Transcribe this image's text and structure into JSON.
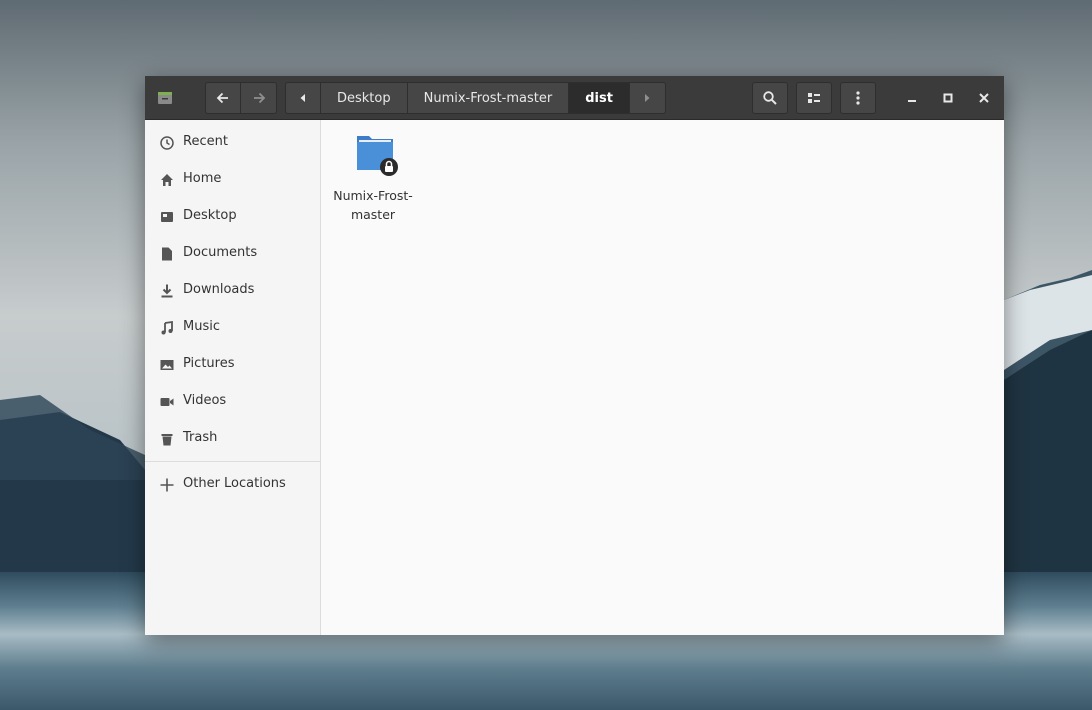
{
  "nav": {
    "back_icon": "arrow-left-icon",
    "forward_icon": "arrow-right-icon"
  },
  "breadcrumb": {
    "items": [
      "Desktop",
      "Numix-Frost-master",
      "dist"
    ],
    "active_index": 2
  },
  "toolbar": {
    "search_icon": "search-icon",
    "view_icon": "list-view-icon",
    "menu_icon": "kebab-menu-icon"
  },
  "window_controls": [
    "minimize-icon",
    "maximize-icon",
    "close-icon"
  ],
  "sidebar": {
    "items": [
      {
        "label": "Recent",
        "icon": "clock-icon"
      },
      {
        "label": "Home",
        "icon": "home-icon"
      },
      {
        "label": "Desktop",
        "icon": "desktop-icon"
      },
      {
        "label": "Documents",
        "icon": "document-icon"
      },
      {
        "label": "Downloads",
        "icon": "download-icon"
      },
      {
        "label": "Music",
        "icon": "music-icon"
      },
      {
        "label": "Pictures",
        "icon": "image-icon"
      },
      {
        "label": "Videos",
        "icon": "video-icon"
      },
      {
        "label": "Trash",
        "icon": "trash-icon"
      }
    ],
    "other_locations": {
      "label": "Other Locations",
      "icon": "plus-icon"
    }
  },
  "files": [
    {
      "line1": "Numix-Frost-",
      "line2": "master",
      "icon": "locked-folder-icon"
    }
  ],
  "colors": {
    "headerbar": "#3b3b3b",
    "folder": "#4a90d9",
    "content_bg": "#fafafa"
  }
}
